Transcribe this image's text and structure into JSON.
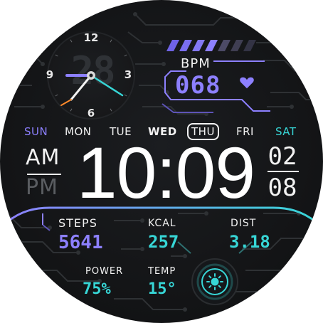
{
  "watch": {
    "analog": {
      "numerals": {
        "twelve": "12",
        "three": "3",
        "six": "6",
        "nine": "9"
      },
      "bg_date": "28"
    },
    "bpm": {
      "label": "BPM",
      "value": "068"
    },
    "days": {
      "sun": "SUN",
      "mon": "MON",
      "tue": "TUE",
      "wed": "WED",
      "thu": "THU",
      "fri": "FRI",
      "sat": "SAT",
      "selected": "THU"
    },
    "ampm": {
      "am": "AM",
      "pm": "PM",
      "active": "AM"
    },
    "time": "10:09",
    "date": {
      "day": "02",
      "month": "08"
    },
    "stats": {
      "steps": {
        "label": "STEPS",
        "value": "5641"
      },
      "kcal": {
        "label": "KCAL",
        "value": "257"
      },
      "dist": {
        "label": "DIST",
        "value": "3.18"
      },
      "power": {
        "label": "POWER",
        "value": "75%"
      },
      "temp": {
        "label": "TEMP",
        "value": "15°"
      }
    },
    "buttons": {
      "light_icon": "sun-icon"
    },
    "colors": {
      "purple": "#8d80ff",
      "cyan": "#37d6d6",
      "white": "#f2f2f2",
      "dim": "#5a5d61",
      "second_hand": "#ff8a2a"
    }
  }
}
